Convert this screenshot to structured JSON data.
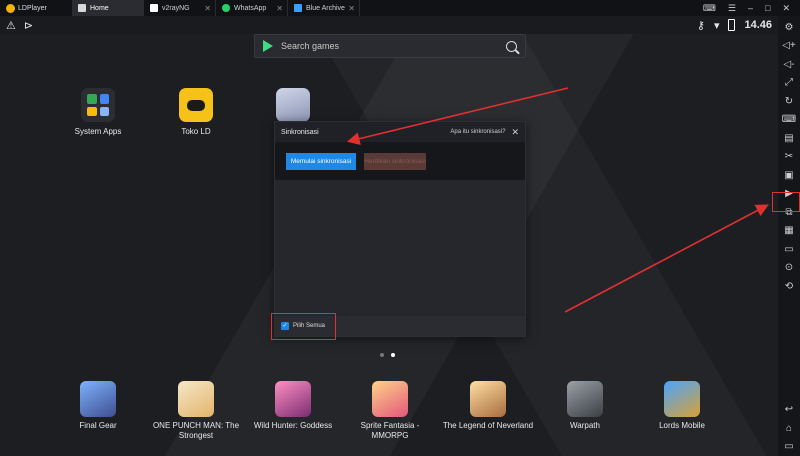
{
  "titlebar": {
    "app_name": "LDPlayer",
    "tabs": [
      {
        "label": "Home",
        "active": true
      },
      {
        "label": "v2rayNG",
        "active": false
      },
      {
        "label": "WhatsApp",
        "active": false
      },
      {
        "label": "Blue Archive",
        "active": false
      }
    ],
    "close_glyph": "✕"
  },
  "statusbar": {
    "time": "14.46"
  },
  "search": {
    "placeholder": "Search games"
  },
  "apps": [
    {
      "label": "System Apps",
      "icon": "system-apps-icon"
    },
    {
      "label": "Toko LD",
      "icon": "toko-ld-icon"
    }
  ],
  "dialog": {
    "title": "Sinkronisasi",
    "help_text": "Apa itu sinkronisasi?",
    "start_button": "Memulai sinkronisasi",
    "stop_button": "Hentikan sinkronisasi",
    "select_all_label": "Pilih Semua",
    "select_all_checked": true
  },
  "pager": {
    "count": 2,
    "active": 1
  },
  "games": [
    {
      "label_line1": "Final Gear",
      "label_line2": ""
    },
    {
      "label_line1": "ONE PUNCH MAN: The",
      "label_line2": "Strongest"
    },
    {
      "label_line1": "Wild Hunter: Goddess",
      "label_line2": ""
    },
    {
      "label_line1": "Sprite Fantasia -",
      "label_line2": "MMORPG"
    },
    {
      "label_line1": "The Legend of Neverland",
      "label_line2": ""
    },
    {
      "label_line1": "Warpath",
      "label_line2": ""
    },
    {
      "label_line1": "Lords Mobile",
      "label_line2": ""
    }
  ],
  "colors": {
    "accent": "#1f88e5",
    "annotation": "#e03030"
  }
}
